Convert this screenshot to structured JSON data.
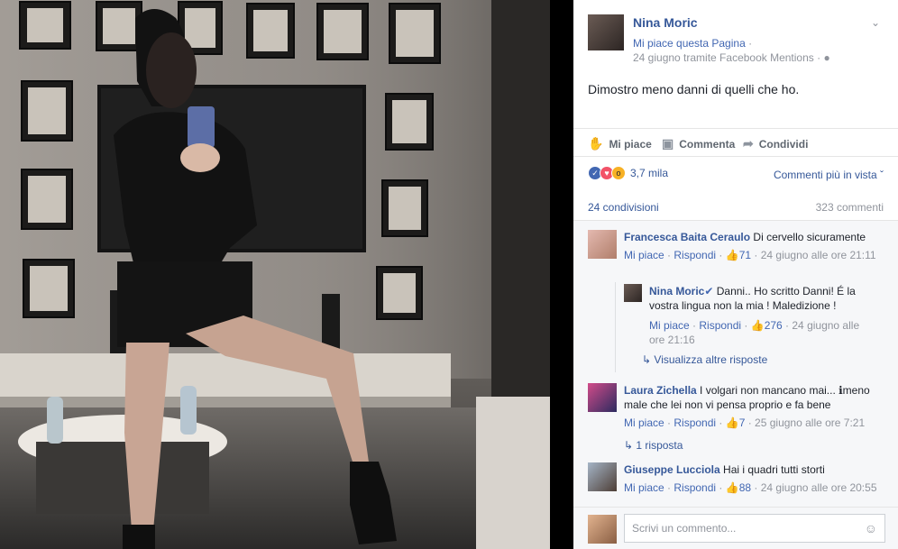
{
  "post": {
    "page_name": "Nina Moric",
    "like_page": "Mi piace questa Pagina",
    "like_sep": "·",
    "meta": "24 giugno tramite Facebook Mentions · ",
    "text": "Dimostro meno danni di quelli che ho."
  },
  "actions": {
    "like": "Mi piace",
    "comment": "Commenta",
    "share": "Condividi"
  },
  "reactions": {
    "count": "3,7 mila",
    "sort": "Commenti più in vista ˇ",
    "shares": "24 condivisioni",
    "comments": "323 commenti"
  },
  "comments": [
    {
      "author": "Francesca Baita Ceraulo",
      "text": " Di cervello sicuramente",
      "like": "Mi piace",
      "sep": " · ",
      "reply": "Rispondi",
      "likes": "71",
      "time": "24 giugno alle ore 21:11"
    },
    {
      "author": "Laura Zichella",
      "text_line1": " I volgari non mancano mai... ℹmeno",
      "text_line2": "male che lei non vi pensa proprio e fa bene",
      "like": "Mi piace",
      "sep": " · ",
      "reply": "Rispondi",
      "likes": "7",
      "time": "25 giugno alle ore 7:21",
      "sub_link": "1 risposta"
    },
    {
      "author": "Giuseppe Lucciola",
      "text": " Hai i quadri tutti storti",
      "like": "Mi piace",
      "sep": " · ",
      "reply": "Rispondi",
      "likes": "88",
      "time": "24 giugno alle ore 20:55"
    }
  ],
  "reply": {
    "author": "Nina Moric",
    "text_line1": " Danni.. Ho scritto Danni! É la",
    "text_line2": "vostra lingua non la mia ! Maledizione !",
    "like": "Mi piace",
    "sep": " · ",
    "reply": "Rispondi",
    "likes": "276",
    "time_line1": " · 24 giugno alle",
    "time_line2": "ore 21:16",
    "more_replies": "Visualizza altre risposte"
  },
  "input": {
    "placeholder": "Scrivi un commento..."
  },
  "colors": {
    "link": "#365899",
    "accent": "#4267b2",
    "muted": "#90949c"
  }
}
